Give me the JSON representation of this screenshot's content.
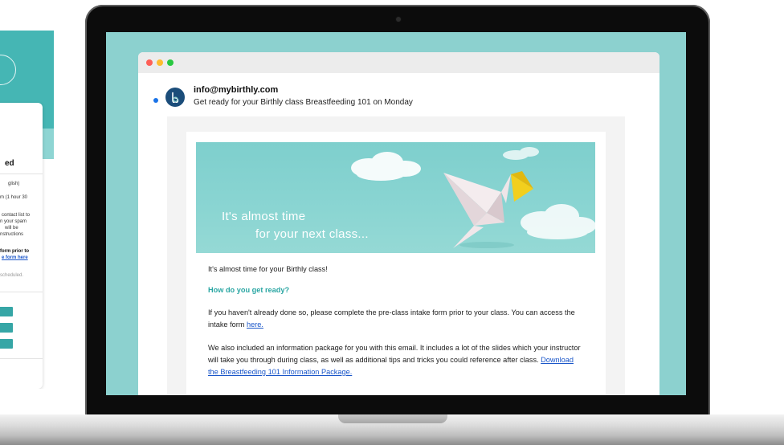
{
  "colors": {
    "accent": "#2aa6a3",
    "link": "#1a56c9",
    "screen_bg": "#8cd1cf",
    "unread": "#1a73e8"
  },
  "left_panel": {
    "title": "ed",
    "lines": [
      "glish)",
      "m (1 hour 30",
      "contact list to",
      "n your spam",
      "will be",
      "nstructions"
    ],
    "form_bold": "form prior to",
    "form_link": "e form here",
    "scheduled": "scheduled."
  },
  "window": {
    "controls": [
      "close",
      "minimize",
      "zoom"
    ]
  },
  "email": {
    "sender": "info@mybirthly.com",
    "subject": "Get ready for your Birthly class Breastfeeding 101 on Monday",
    "hero": {
      "line1": "It's almost time",
      "line2": "for your next class..."
    },
    "intro": "It's almost time for your Birthly class!",
    "heading": "How do you get ready?",
    "para1": "If you haven't already done so, please complete the pre-class intake form prior to your class. You can access the intake form ",
    "para1_link": "here.",
    "para2": "We also included an information package for you with this email. It includes a lot of the slides which your instructor will take you through during class, as well as additional tips and tricks you could reference after class. ",
    "para2_link": "Download the Breastfeeding 101 Information Package."
  }
}
